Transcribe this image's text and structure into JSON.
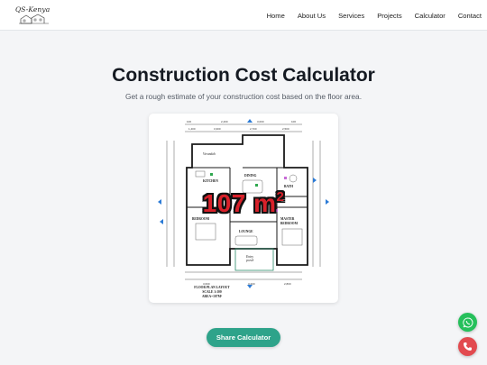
{
  "header": {
    "logo_text": "QS-Kenya",
    "nav": [
      "Home",
      "About Us",
      "Services",
      "Projects",
      "Calculator",
      "Contact"
    ]
  },
  "hero": {
    "title": "Construction Cost Calculator",
    "subtitle": "Get a rough estimate of your construction cost based on the floor area."
  },
  "floor_plan": {
    "area_value": "107",
    "area_unit": "m",
    "area_exp": "2",
    "rooms": [
      "Verandah",
      "KITCHEN",
      "DINING",
      "BATH",
      "BEDROOM",
      "MASTER BEDROOM",
      "LOUNGE",
      "Entry porch"
    ],
    "caption_lines": [
      "FLOOR PLAN LAYOUT",
      "SCALE 1:100",
      "AREA=107M²"
    ]
  },
  "share_label": "Share Calculator",
  "colors": {
    "accent": "#2ea38a",
    "badge_red": "#d8212a",
    "whatsapp": "#25c05b",
    "phone": "#e24a4f"
  },
  "icons": {
    "whatsapp": "whatsapp-icon",
    "phone": "phone-icon"
  }
}
